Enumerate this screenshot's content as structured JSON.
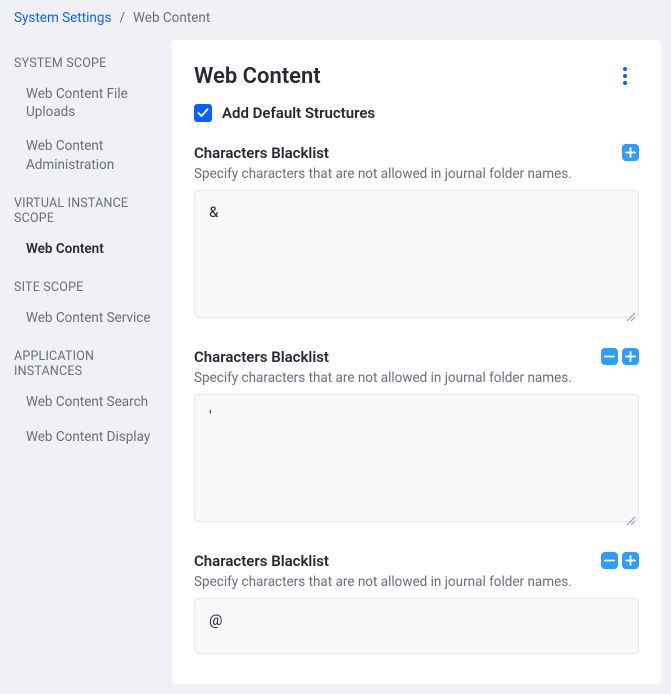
{
  "breadcrumb": {
    "root": "System Settings",
    "sep": "/",
    "current": "Web Content"
  },
  "sidebar": {
    "groups": [
      {
        "title": "SYSTEM SCOPE",
        "items": [
          {
            "label": "Web Content File Uploads"
          },
          {
            "label": "Web Content Administration"
          }
        ]
      },
      {
        "title": "VIRTUAL INSTANCE SCOPE",
        "items": [
          {
            "label": "Web Content",
            "active": true
          }
        ]
      },
      {
        "title": "SITE SCOPE",
        "items": [
          {
            "label": "Web Content Service"
          }
        ]
      },
      {
        "title": "APPLICATION INSTANCES",
        "items": [
          {
            "label": "Web Content Search"
          },
          {
            "label": "Web Content Display"
          }
        ]
      }
    ]
  },
  "card": {
    "title": "Web Content",
    "checkbox_label": "Add Default Structures",
    "checkbox_checked": true,
    "fields": [
      {
        "label": "Characters Blacklist",
        "help": "Specify characters that are not allowed in journal folder names.",
        "value": "&",
        "has_remove": false,
        "has_add": true
      },
      {
        "label": "Characters Blacklist",
        "help": "Specify characters that are not allowed in journal folder names.",
        "value": "'",
        "has_remove": true,
        "has_add": true
      },
      {
        "label": "Characters Blacklist",
        "help": "Specify characters that are not allowed in journal folder names.",
        "value": "@",
        "has_remove": true,
        "has_add": true
      }
    ]
  }
}
